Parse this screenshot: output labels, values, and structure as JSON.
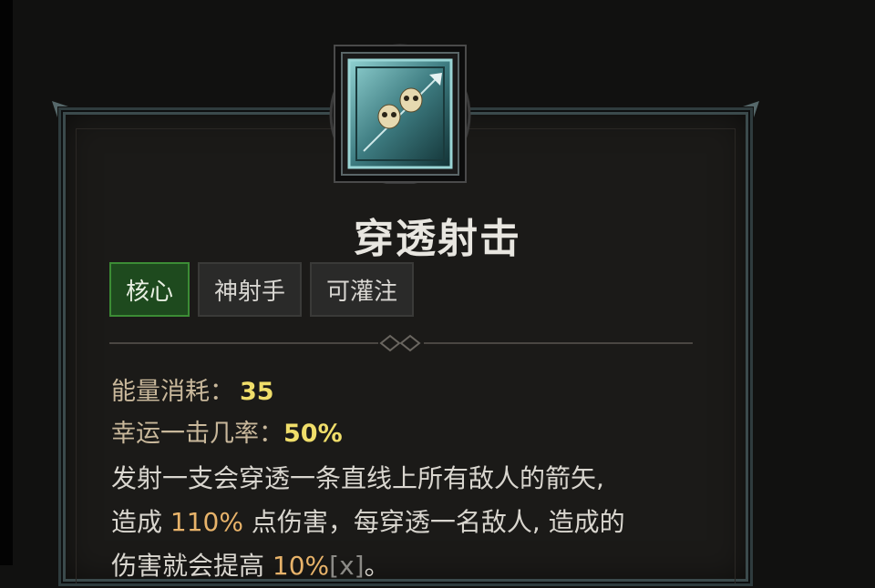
{
  "skill": {
    "name": "穿透射击",
    "icon": "piercing-shot-skull-arrow-icon",
    "tags": [
      {
        "label": "核心",
        "active": true
      },
      {
        "label": "神射手",
        "active": false
      },
      {
        "label": "可灌注",
        "active": false
      }
    ],
    "stats": [
      {
        "label": "能量消耗：",
        "value": "35"
      },
      {
        "label": "幸运一击几率：",
        "value": "50%"
      }
    ],
    "description": {
      "line1": "发射一支会穿透一条直线上所有敌人的箭矢,",
      "line2_prefix": "造成 ",
      "line2_damage": "110%",
      "line2_suffix": " 点伤害，每穿透一名敌人, 造成的",
      "line3_prefix": "伤害就会提高 ",
      "line3_bonus": "10%",
      "line3_scaling": "[x]",
      "line3_end": "。"
    }
  },
  "colors": {
    "background": "#111110",
    "panel": "#1b1a18",
    "core_tag": "#1e4a1e",
    "core_tag_border": "#3c8c35",
    "stat_label": "#c9b89b",
    "stat_value": "#f0de6a",
    "highlight": "#e8b36a"
  }
}
